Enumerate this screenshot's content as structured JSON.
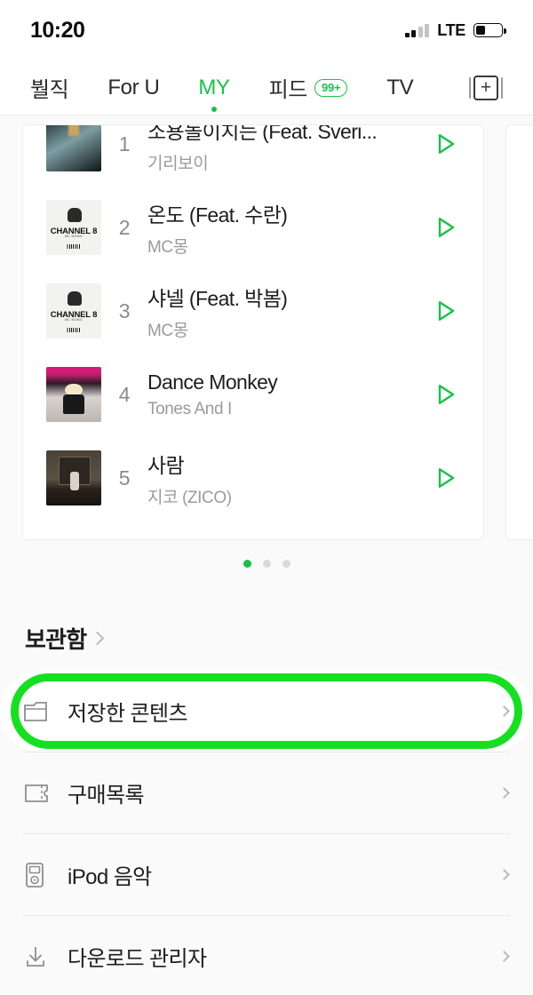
{
  "statusbar": {
    "time": "10:20",
    "network": "LTE",
    "signal_icon": "signal-bars-icon",
    "battery_icon": "battery-icon",
    "battery_level_pct": 38
  },
  "tabs": [
    {
      "label": "붤직",
      "active": false,
      "badge": null
    },
    {
      "label": "For U",
      "active": false,
      "badge": null
    },
    {
      "label": "MY",
      "active": true,
      "badge": null
    },
    {
      "label": "피드",
      "active": false,
      "badge": "99+"
    },
    {
      "label": "TV",
      "active": false,
      "badge": null
    }
  ],
  "add_button": {
    "label": "+",
    "icon": "add-square-icon"
  },
  "chart_card": {
    "songs": [
      {
        "rank": "1",
        "title": "소용돌이치는 (Feat. Sveri...",
        "artist": "기리보이",
        "art": "a1",
        "art_text": "",
        "art_sub": ""
      },
      {
        "rank": "2",
        "title": "온도 (Feat. 수란)",
        "artist": "MC몽",
        "art": "ch",
        "art_text": "CHANNEL 8",
        "art_sub": "MC MONG"
      },
      {
        "rank": "3",
        "title": "샤넬 (Feat. 박봄)",
        "artist": "MC몽",
        "art": "ch",
        "art_text": "CHANNEL 8",
        "art_sub": "MC MONG"
      },
      {
        "rank": "4",
        "title": "Dance Monkey",
        "artist": "Tones And I",
        "art": "a4",
        "art_text": "",
        "art_sub": ""
      },
      {
        "rank": "5",
        "title": "사람",
        "artist": "지코 (ZICO)",
        "art": "a5",
        "art_text": "",
        "art_sub": ""
      }
    ],
    "play_icon": "play-triangle-icon"
  },
  "pager": {
    "total": 3,
    "active_index": 0
  },
  "library": {
    "heading": "보관함",
    "heading_chevron_icon": "chevron-right-icon",
    "items": [
      {
        "label": "저장한 콘텐츠",
        "icon": "folder-icon",
        "highlighted": true
      },
      {
        "label": "구매목록",
        "icon": "ticket-icon",
        "highlighted": false
      },
      {
        "label": "iPod 음악",
        "icon": "ipod-icon",
        "highlighted": false
      },
      {
        "label": "다운로드 관리자",
        "icon": "download-icon",
        "highlighted": false
      }
    ],
    "row_chevron_icon": "chevron-right-icon"
  },
  "colors": {
    "accent_green": "#18c249",
    "highlight_ring": "#15e020",
    "page_bg": "#fafafa",
    "card_bg": "#ffffff",
    "text_primary": "#1d1d1f",
    "text_secondary": "#9b9b9f"
  }
}
